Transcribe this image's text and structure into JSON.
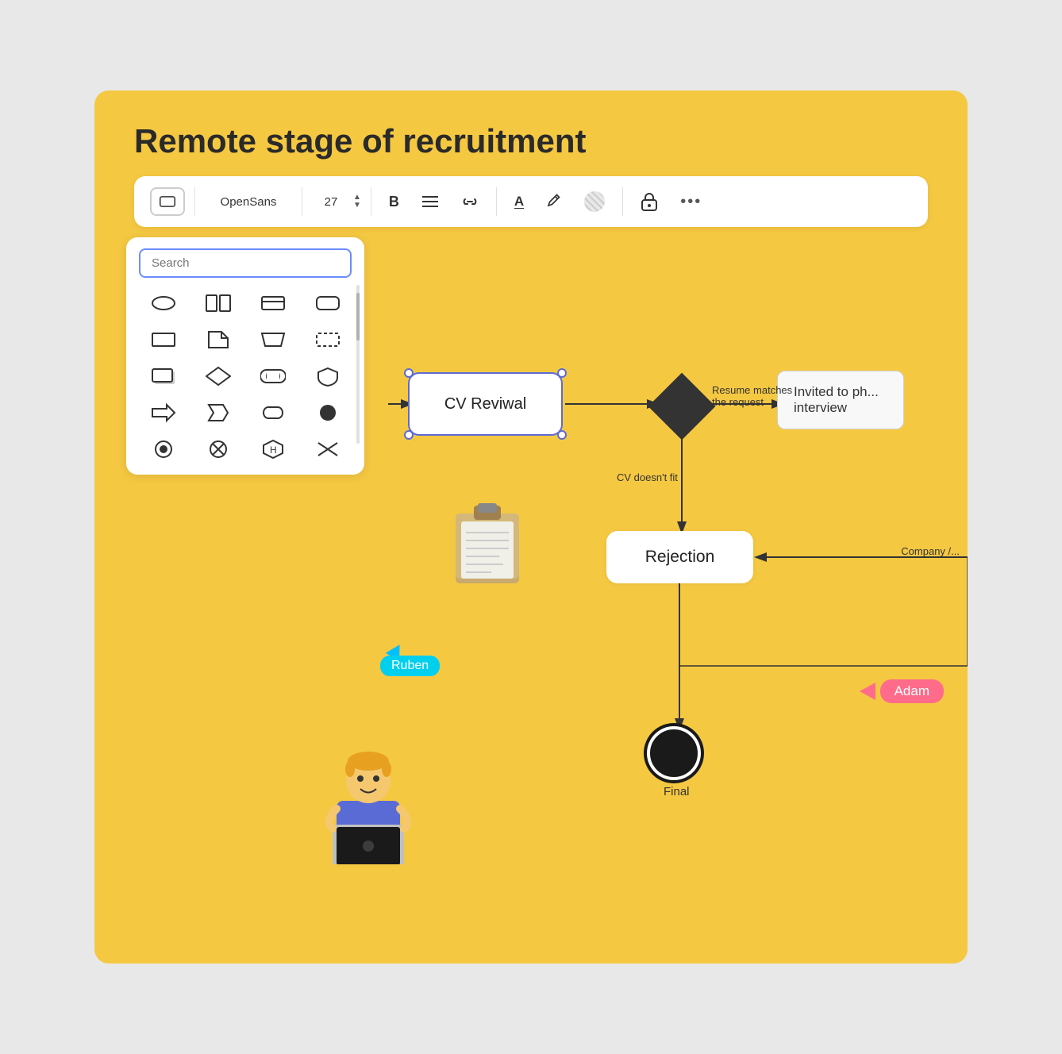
{
  "page": {
    "title": "Remote stage of recruitment",
    "background": "#f5c842"
  },
  "toolbar": {
    "shape_icon": "▭",
    "font_name": "OpenSans",
    "font_size": "27",
    "bold_label": "B",
    "align_label": "≡",
    "link_label": "🔗",
    "text_color_label": "A",
    "pen_label": "✏",
    "pattern_label": "⊞",
    "lock_label": "🔒",
    "more_label": "•••"
  },
  "shape_panel": {
    "search_placeholder": "Search",
    "shapes": [
      "ellipse",
      "columns",
      "card",
      "rect-rounded",
      "rect",
      "doc-folded",
      "trapezoid",
      "dashed-rect",
      "rect-shadow",
      "diamond",
      "stadium",
      "shield",
      "arrow-right",
      "chevron",
      "pill",
      "circle-filled",
      "circle-target",
      "circle-x",
      "hexagon",
      "cross"
    ]
  },
  "diagram": {
    "title": "CV Reviwal",
    "nodes": {
      "cv_revival": "CV Reviwal",
      "invited": "Invited to ph...\ninterview",
      "rejection": "Rejection",
      "final": "Final"
    },
    "edge_labels": {
      "resume_matches": "Resume matches\nthe request",
      "cv_doesnt_fit": "CV doesn't fit",
      "company": "Company /..."
    }
  },
  "cursors": {
    "ruben": "Ruben",
    "adam": "Adam"
  }
}
